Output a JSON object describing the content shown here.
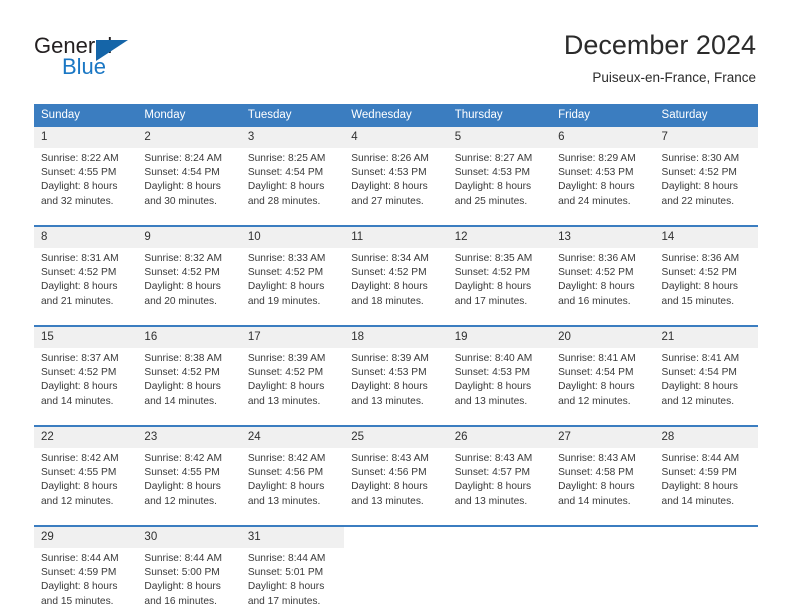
{
  "logo": {
    "word_top": "General",
    "word_bottom": "Blue",
    "flag_color": "#1565a8",
    "blue_color": "#1a77c4",
    "dark_color": "#231f20"
  },
  "header": {
    "title": "December 2024",
    "location": "Puiseux-en-France, France"
  },
  "theme": {
    "header_blue": "#3b7dc0",
    "daynum_gray": "#f0f0f0",
    "text_dark": "#303030"
  },
  "weekdays": [
    "Sunday",
    "Monday",
    "Tuesday",
    "Wednesday",
    "Thursday",
    "Friday",
    "Saturday"
  ],
  "weeks": [
    [
      {
        "day": "1",
        "details": "Sunrise: 8:22 AM\nSunset: 4:55 PM\nDaylight: 8 hours\nand 32 minutes."
      },
      {
        "day": "2",
        "details": "Sunrise: 8:24 AM\nSunset: 4:54 PM\nDaylight: 8 hours\nand 30 minutes."
      },
      {
        "day": "3",
        "details": "Sunrise: 8:25 AM\nSunset: 4:54 PM\nDaylight: 8 hours\nand 28 minutes."
      },
      {
        "day": "4",
        "details": "Sunrise: 8:26 AM\nSunset: 4:53 PM\nDaylight: 8 hours\nand 27 minutes."
      },
      {
        "day": "5",
        "details": "Sunrise: 8:27 AM\nSunset: 4:53 PM\nDaylight: 8 hours\nand 25 minutes."
      },
      {
        "day": "6",
        "details": "Sunrise: 8:29 AM\nSunset: 4:53 PM\nDaylight: 8 hours\nand 24 minutes."
      },
      {
        "day": "7",
        "details": "Sunrise: 8:30 AM\nSunset: 4:52 PM\nDaylight: 8 hours\nand 22 minutes."
      }
    ],
    [
      {
        "day": "8",
        "details": "Sunrise: 8:31 AM\nSunset: 4:52 PM\nDaylight: 8 hours\nand 21 minutes."
      },
      {
        "day": "9",
        "details": "Sunrise: 8:32 AM\nSunset: 4:52 PM\nDaylight: 8 hours\nand 20 minutes."
      },
      {
        "day": "10",
        "details": "Sunrise: 8:33 AM\nSunset: 4:52 PM\nDaylight: 8 hours\nand 19 minutes."
      },
      {
        "day": "11",
        "details": "Sunrise: 8:34 AM\nSunset: 4:52 PM\nDaylight: 8 hours\nand 18 minutes."
      },
      {
        "day": "12",
        "details": "Sunrise: 8:35 AM\nSunset: 4:52 PM\nDaylight: 8 hours\nand 17 minutes."
      },
      {
        "day": "13",
        "details": "Sunrise: 8:36 AM\nSunset: 4:52 PM\nDaylight: 8 hours\nand 16 minutes."
      },
      {
        "day": "14",
        "details": "Sunrise: 8:36 AM\nSunset: 4:52 PM\nDaylight: 8 hours\nand 15 minutes."
      }
    ],
    [
      {
        "day": "15",
        "details": "Sunrise: 8:37 AM\nSunset: 4:52 PM\nDaylight: 8 hours\nand 14 minutes."
      },
      {
        "day": "16",
        "details": "Sunrise: 8:38 AM\nSunset: 4:52 PM\nDaylight: 8 hours\nand 14 minutes."
      },
      {
        "day": "17",
        "details": "Sunrise: 8:39 AM\nSunset: 4:52 PM\nDaylight: 8 hours\nand 13 minutes."
      },
      {
        "day": "18",
        "details": "Sunrise: 8:39 AM\nSunset: 4:53 PM\nDaylight: 8 hours\nand 13 minutes."
      },
      {
        "day": "19",
        "details": "Sunrise: 8:40 AM\nSunset: 4:53 PM\nDaylight: 8 hours\nand 13 minutes."
      },
      {
        "day": "20",
        "details": "Sunrise: 8:41 AM\nSunset: 4:54 PM\nDaylight: 8 hours\nand 12 minutes."
      },
      {
        "day": "21",
        "details": "Sunrise: 8:41 AM\nSunset: 4:54 PM\nDaylight: 8 hours\nand 12 minutes."
      }
    ],
    [
      {
        "day": "22",
        "details": "Sunrise: 8:42 AM\nSunset: 4:55 PM\nDaylight: 8 hours\nand 12 minutes."
      },
      {
        "day": "23",
        "details": "Sunrise: 8:42 AM\nSunset: 4:55 PM\nDaylight: 8 hours\nand 12 minutes."
      },
      {
        "day": "24",
        "details": "Sunrise: 8:42 AM\nSunset: 4:56 PM\nDaylight: 8 hours\nand 13 minutes."
      },
      {
        "day": "25",
        "details": "Sunrise: 8:43 AM\nSunset: 4:56 PM\nDaylight: 8 hours\nand 13 minutes."
      },
      {
        "day": "26",
        "details": "Sunrise: 8:43 AM\nSunset: 4:57 PM\nDaylight: 8 hours\nand 13 minutes."
      },
      {
        "day": "27",
        "details": "Sunrise: 8:43 AM\nSunset: 4:58 PM\nDaylight: 8 hours\nand 14 minutes."
      },
      {
        "day": "28",
        "details": "Sunrise: 8:44 AM\nSunset: 4:59 PM\nDaylight: 8 hours\nand 14 minutes."
      }
    ],
    [
      {
        "day": "29",
        "details": "Sunrise: 8:44 AM\nSunset: 4:59 PM\nDaylight: 8 hours\nand 15 minutes."
      },
      {
        "day": "30",
        "details": "Sunrise: 8:44 AM\nSunset: 5:00 PM\nDaylight: 8 hours\nand 16 minutes."
      },
      {
        "day": "31",
        "details": "Sunrise: 8:44 AM\nSunset: 5:01 PM\nDaylight: 8 hours\nand 17 minutes."
      },
      {
        "day": "",
        "details": ""
      },
      {
        "day": "",
        "details": ""
      },
      {
        "day": "",
        "details": ""
      },
      {
        "day": "",
        "details": ""
      }
    ]
  ]
}
